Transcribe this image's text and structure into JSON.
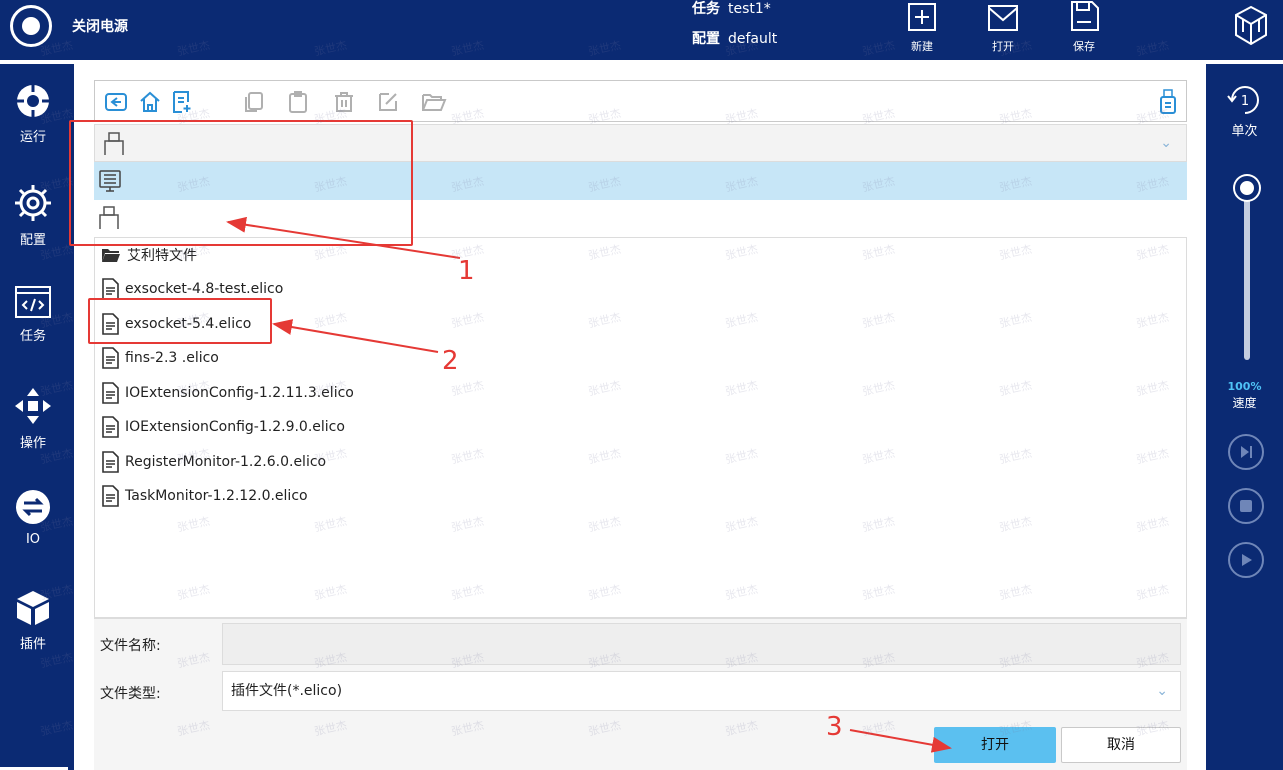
{
  "topbar": {
    "power_label": "关闭电源",
    "task_key": "任务",
    "task_value": "test1*",
    "config_key": "配置",
    "config_value": "default",
    "tools": [
      {
        "label": "新建",
        "icon": "plus-square-icon"
      },
      {
        "label": "打开",
        "icon": "envelope-icon"
      },
      {
        "label": "保存",
        "icon": "save-icon"
      }
    ]
  },
  "left_sidebar": {
    "items": [
      {
        "label": "运行",
        "icon": "run-icon"
      },
      {
        "label": "配置",
        "icon": "gear-icon"
      },
      {
        "label": "任务",
        "icon": "code-window-icon"
      },
      {
        "label": "操作",
        "icon": "move-arrows-icon"
      },
      {
        "label": "IO",
        "icon": "io-icon"
      },
      {
        "label": "插件",
        "icon": "cube-icon"
      }
    ]
  },
  "right_sidebar": {
    "mode_label": "单次",
    "mode_number": "1",
    "speed_percent": "100%",
    "speed_label": "速度",
    "speed_level": 1.0
  },
  "dialog": {
    "toolbar_icons": [
      "back-icon",
      "home-icon",
      "new-file-icon",
      "copy-icon",
      "paste-icon",
      "delete-icon",
      "edit-icon",
      "open-folder-icon",
      "usb-icon"
    ],
    "files": [
      {
        "name": "艾利特文件",
        "type": "folder"
      },
      {
        "name": "exsocket-4.8-test.elico",
        "type": "file"
      },
      {
        "name": "exsocket-5.4.elico",
        "type": "file"
      },
      {
        "name": "fins-2.3 .elico",
        "type": "file"
      },
      {
        "name": "IOExtensionConfig-1.2.11.3.elico",
        "type": "file"
      },
      {
        "name": "IOExtensionConfig-1.2.9.0.elico",
        "type": "file"
      },
      {
        "name": "RegisterMonitor-1.2.6.0.elico",
        "type": "file"
      },
      {
        "name": "TaskMonitor-1.2.12.0.elico",
        "type": "file"
      }
    ],
    "file_name_label": "文件名称:",
    "file_name_value": "",
    "file_type_label": "文件类型:",
    "file_type_value": "插件文件(*.elico)",
    "open_label": "打开",
    "cancel_label": "取消"
  },
  "annotations": {
    "n1": "1",
    "n2": "2",
    "n3": "3"
  },
  "watermark_text": "张世杰",
  "colors": {
    "brand_navy": "#0b2a73",
    "accent_blue": "#2a8fd6",
    "selected_row": "#c7e6f7",
    "open_button": "#5bc0f0",
    "annotation_red": "#e53935"
  }
}
